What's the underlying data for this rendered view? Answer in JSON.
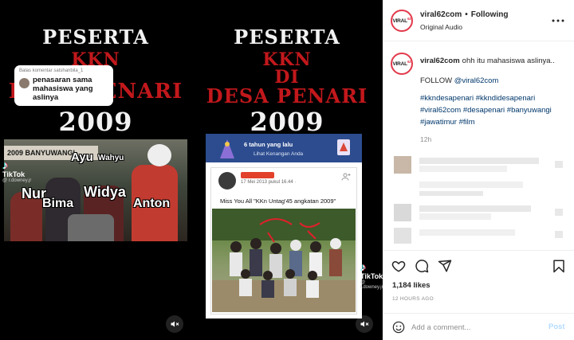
{
  "media": {
    "clip1": {
      "title1": "PESERTA",
      "title2": "KKN",
      "title3": "DESA PENARI",
      "year": "2009",
      "reply": {
        "header": "Balas komentar satshanbila_1",
        "text": "penasaran sama mahasiswa yang aslinya"
      },
      "photo": {
        "banner": "2009 BANYUWANGI",
        "names": [
          "Ayu",
          "Wahyu",
          "Nur",
          "Widya",
          "Bima",
          "Anton"
        ]
      },
      "tiktok": {
        "brand": "TikTok",
        "handle": "@ r.downey.jr"
      }
    },
    "clip2": {
      "title1": "PESERTA",
      "title2": "KKN",
      "title3": "DI",
      "title4": "DESA PENARI",
      "year": "2009",
      "fb": {
        "header": "6 tahun yang lalu",
        "link": "Lihat Kenangan Anda",
        "date": "17 Mei 2013 pukul 16.44 · ",
        "text": "Miss You All \"KKn Untag'45 angkatan 2009\""
      },
      "tiktok": {
        "brand": "TikTok",
        "handle": "@ r.downey.jr"
      }
    }
  },
  "sidebar": {
    "header": {
      "avatar_text": "VIRAL",
      "avatar_sup": "62",
      "username": "viral62com",
      "dot": "•",
      "follow_state": "Following",
      "subtitle": "Original Audio",
      "more_icon": "more-horizontal-icon"
    },
    "caption": {
      "username": "viral62com",
      "text": "ohh itu mahasiswa aslinya..",
      "follow_line": "FOLLOW ",
      "follow_link": "@viral62com",
      "hashtags_line1": "#kkndesapenari #kkndidesapenari",
      "hashtags_line2": "#viral62com #desapenari #banyuwangi",
      "hashtags_line3": "#jawatimur #film",
      "time": "12h"
    },
    "likes": "1,184 likes",
    "ago": "12 HOURS AGO",
    "comment": {
      "placeholder": "Add a comment...",
      "post_label": "Post"
    }
  },
  "colors": {
    "ig_link": "#00376b",
    "horror_red": "#c2181c",
    "post_disabled": "#b3dbff"
  }
}
